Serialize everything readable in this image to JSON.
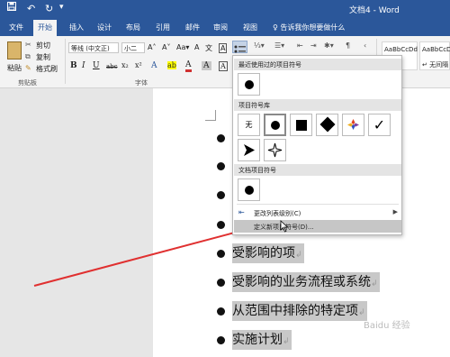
{
  "titlebar": {
    "save_icon": "save-icon",
    "undo_symbol": "↶",
    "redo_symbol": "↻",
    "more_symbol": "▾",
    "doc_title": "文档4 - Word"
  },
  "tabs": [
    {
      "label": "文件"
    },
    {
      "label": "开始"
    },
    {
      "label": "插入"
    },
    {
      "label": "设计"
    },
    {
      "label": "布局"
    },
    {
      "label": "引用"
    },
    {
      "label": "邮件"
    },
    {
      "label": "审阅"
    },
    {
      "label": "视图"
    }
  ],
  "tellme": "♀ 告诉我你想要做什么",
  "ribbon": {
    "paste_label": "粘贴",
    "cut_label": "剪切",
    "copy_label": "复制",
    "painter_label": "格式刷",
    "clipboard_group": "剪贴板",
    "font_name": "等线 (中文正)",
    "font_size": "小二",
    "font_group": "字体",
    "bold": "B",
    "italic": "I",
    "underline": "U",
    "strike": "abc",
    "sub": "x₂",
    "sup": "x²",
    "grow": "A˄",
    "shrink": "A˅",
    "case": "Aa▾",
    "clear_fmt": "A",
    "wen": "文",
    "char_border": "A",
    "highlight": "ab",
    "font_color": "A",
    "char_shade": "A",
    "style1_text": "AaBbCcDd",
    "style1_label": "文",
    "style2_text": "AaBbCcDd",
    "style2_label": "↵ 无间隔"
  },
  "dropdown": {
    "recent_header": "最近使用过的项目符号",
    "library_header": "项目符号库",
    "none_label": "无",
    "document_header": "文档项目符号",
    "change_level": "更改列表级别(C)",
    "define_new": "定义新项目符号(D)..."
  },
  "document": {
    "lines": [
      {
        "text": "受影响的项"
      },
      {
        "text": "受影响的业务流程或系统"
      },
      {
        "text": "从范围中排除的特定项"
      },
      {
        "text": "实施计划"
      }
    ],
    "para_mark": "↲"
  },
  "watermark": "Baidu 经验"
}
